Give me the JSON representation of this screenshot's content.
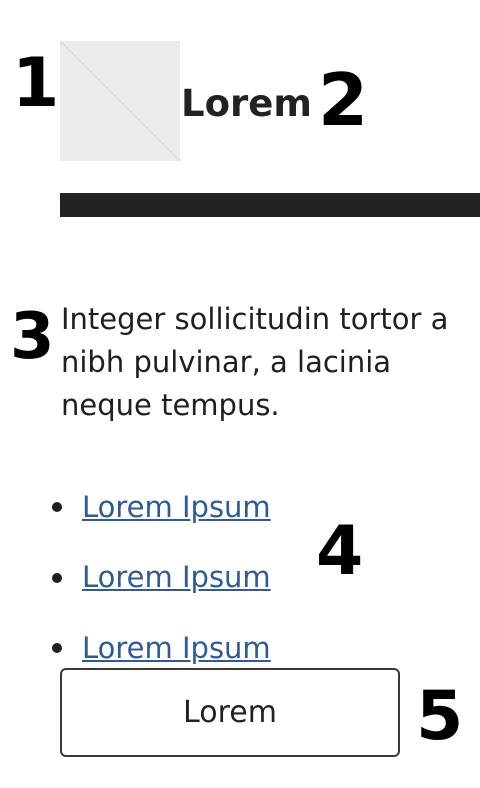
{
  "markers": [
    "1",
    "2",
    "3",
    "4",
    "5"
  ],
  "header": {
    "thumbnail_icon": "image-placeholder-icon",
    "title": "Lorem"
  },
  "content": {
    "paragraph": "Integer sollicitudin tortor a nibh pulvinar, a lacinia neque tempus."
  },
  "links": [
    {
      "label": "Lorem Ipsum"
    },
    {
      "label": "Lorem Ipsum"
    },
    {
      "label": "Lorem Ipsum"
    }
  ],
  "button": {
    "label": "Lorem"
  },
  "colors": {
    "divider": "#222222",
    "thumbnail_bg": "#ececec",
    "link": "#2d5a9a",
    "button_border": "#3a3a3a"
  }
}
